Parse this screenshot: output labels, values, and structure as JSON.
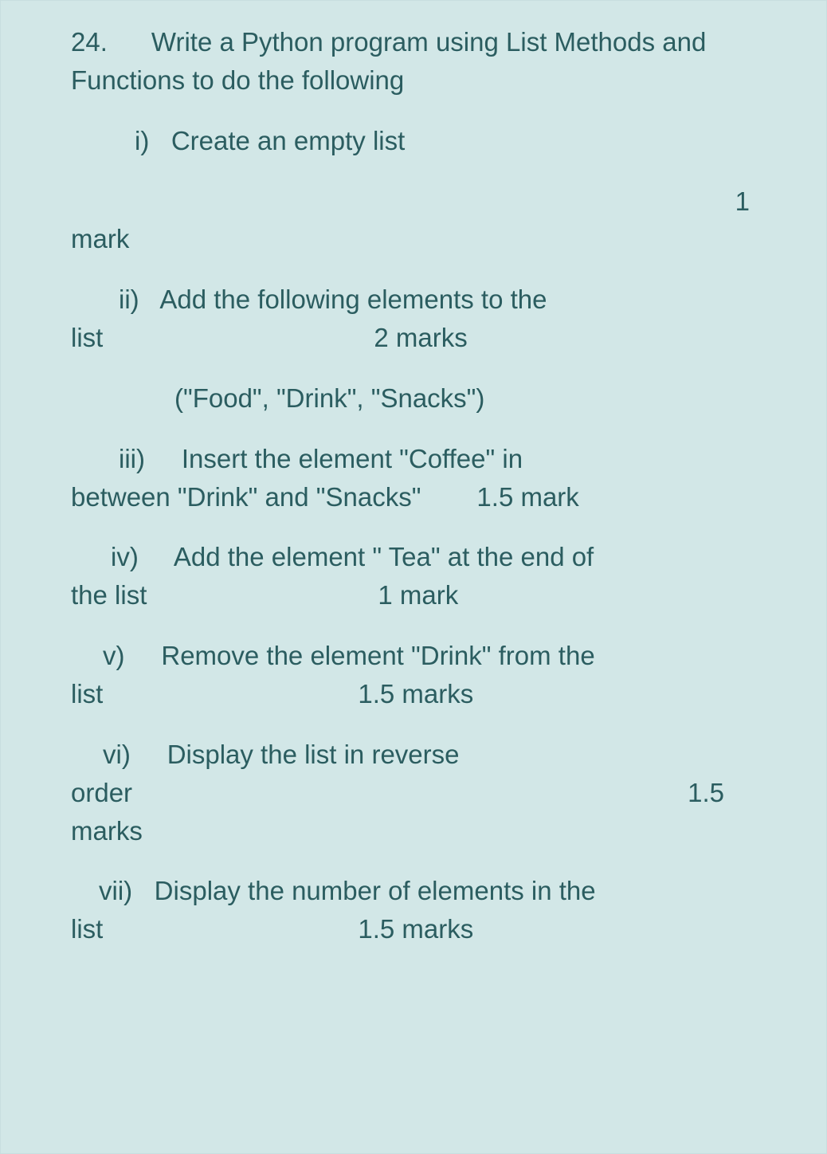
{
  "question": {
    "number": "24.",
    "prompt": "Write a Python program using List Methods and Functions to do the following",
    "items": {
      "i": {
        "label": "i)",
        "text": "Create an empty list",
        "marks_number": "1",
        "marks_word": "mark"
      },
      "ii": {
        "label": "ii)",
        "text": "Add the following elements to the",
        "list_word": "list",
        "marks": "2 marks",
        "tuple": "(\"Food\", \"Drink\", \"Snacks\")"
      },
      "iii": {
        "label": "iii)",
        "text_a": "Insert the element  \"Coffee\" in",
        "text_b": "between \"Drink\" and \"Snacks\"",
        "marks": "1.5 mark"
      },
      "iv": {
        "label": "iv)",
        "text": "Add the element \" Tea\" at the end of",
        "the_list": "the list",
        "marks": "1 mark"
      },
      "v": {
        "label": "v)",
        "text": "Remove the element \"Drink\" from the",
        "list_word": "list",
        "marks": "1.5 marks"
      },
      "vi": {
        "label": "vi)",
        "text": "Display the list in reverse",
        "order_word": "order",
        "marks": "1.5",
        "marks_word": "marks"
      },
      "vii": {
        "label": "vii)",
        "text": "Display the number of elements in the",
        "list_word": "list",
        "marks": "1.5 marks"
      }
    }
  }
}
